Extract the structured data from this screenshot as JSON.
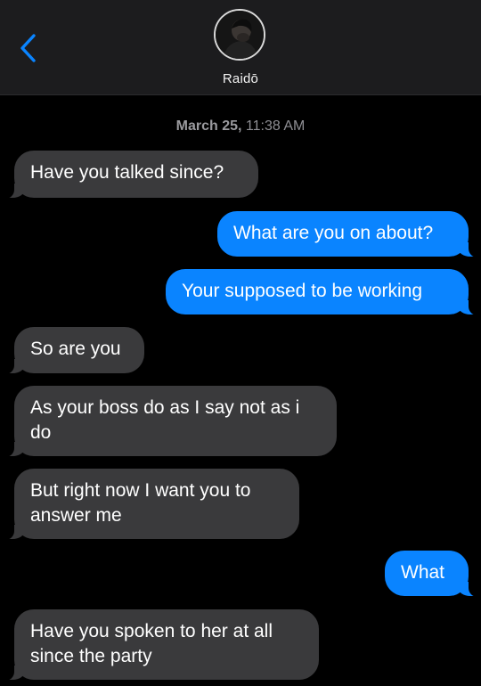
{
  "header": {
    "back_icon": "chevron-left-icon",
    "avatar_icon": "contact-photo",
    "contact_name": "Raidō"
  },
  "conversation": {
    "timestamp_date": "March 25,",
    "timestamp_time": "11:38 AM",
    "messages": [
      {
        "direction": "incoming",
        "text": "Have you talked since?"
      },
      {
        "direction": "outgoing",
        "text": "What are you on about?"
      },
      {
        "direction": "outgoing",
        "text": "Your supposed to be working"
      },
      {
        "direction": "incoming",
        "text": "So are you"
      },
      {
        "direction": "incoming",
        "text": "As your boss do as I say not as i do"
      },
      {
        "direction": "incoming",
        "text": "But right now I want you to answer me"
      },
      {
        "direction": "outgoing",
        "text": "What"
      },
      {
        "direction": "incoming",
        "text": "Have you spoken to her at all since the party"
      }
    ]
  },
  "colors": {
    "background": "#000000",
    "header_bg": "#1c1c1e",
    "incoming_bubble": "#3a3a3c",
    "outgoing_bubble": "#0a84ff",
    "accent": "#0a84ff",
    "timestamp": "#8e8e93"
  }
}
